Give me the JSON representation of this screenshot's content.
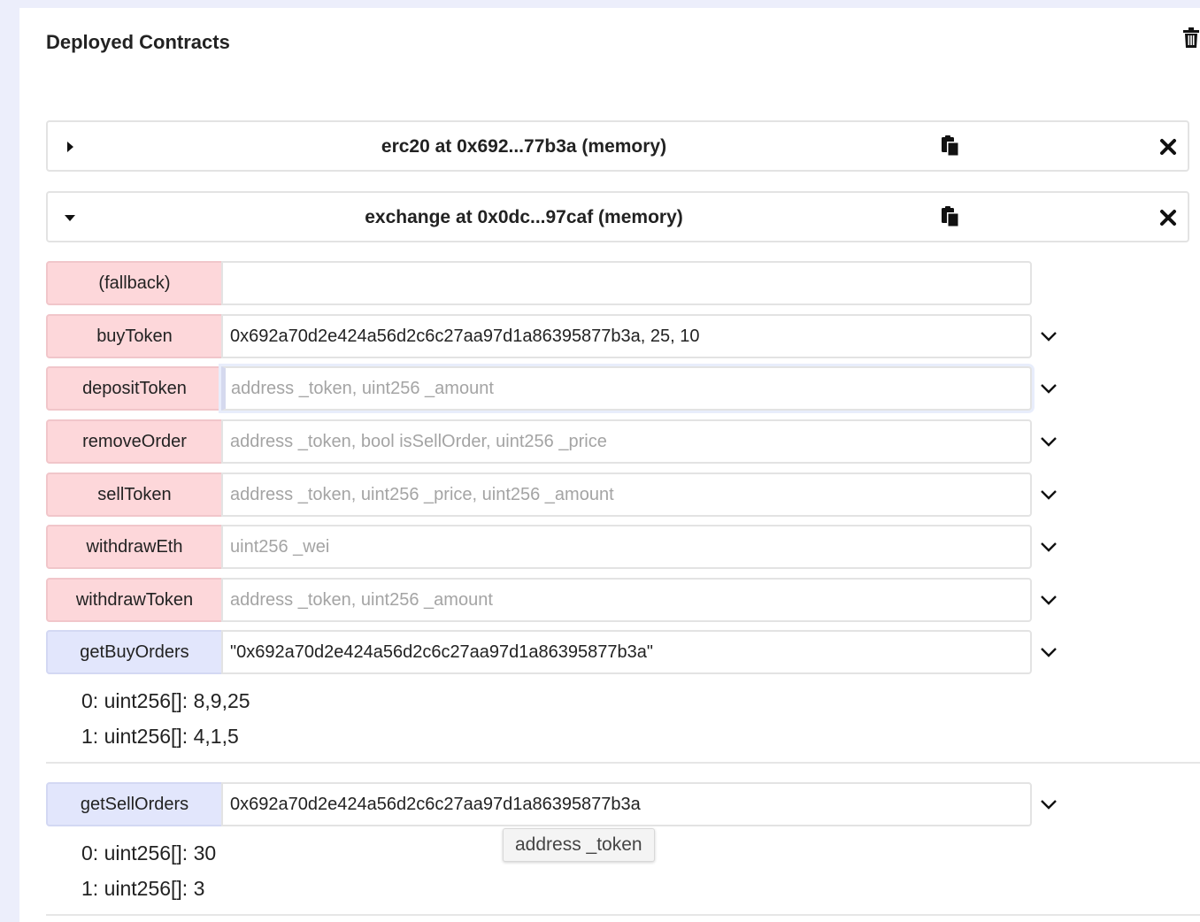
{
  "header": {
    "title": "Deployed Contracts"
  },
  "instances": [
    {
      "title": "erc20 at 0x692...77b3a (memory)",
      "expanded": false
    },
    {
      "title": "exchange at 0x0dc...97caf (memory)",
      "expanded": true
    }
  ],
  "functions": {
    "fallback": {
      "label": "(fallback)",
      "value": "",
      "placeholder": ""
    },
    "buyToken": {
      "label": "buyToken",
      "value": "0x692a70d2e424a56d2c6c27aa97d1a86395877b3a, 25, 10",
      "placeholder": ""
    },
    "depositToken": {
      "label": "depositToken",
      "value": "",
      "placeholder": "address _token, uint256 _amount"
    },
    "removeOrder": {
      "label": "removeOrder",
      "value": "",
      "placeholder": "address _token, bool isSellOrder, uint256 _price"
    },
    "sellToken": {
      "label": "sellToken",
      "value": "",
      "placeholder": "address _token, uint256 _price, uint256 _amount"
    },
    "withdrawEth": {
      "label": "withdrawEth",
      "value": "",
      "placeholder": "uint256 _wei"
    },
    "withdrawToken": {
      "label": "withdrawToken",
      "value": "",
      "placeholder": "address _token, uint256 _amount"
    },
    "getBuyOrders": {
      "label": "getBuyOrders",
      "value": "\"0x692a70d2e424a56d2c6c27aa97d1a86395877b3a\"",
      "placeholder": "",
      "outputs": [
        "0: uint256[]: 8,9,25",
        "1: uint256[]: 4,1,5"
      ]
    },
    "getSellOrders": {
      "label": "getSellOrders",
      "value": "0x692a70d2e424a56d2c6c27aa97d1a86395877b3a",
      "placeholder": "",
      "outputs": [
        "0: uint256[]: 30",
        "1: uint256[]: 3"
      ]
    }
  },
  "tooltip": {
    "text": "address _token"
  },
  "icons": {
    "trash": "trash-icon",
    "copy": "clipboard-copy-icon",
    "close": "close-icon",
    "caret_right": "caret-right-icon",
    "caret_down": "caret-down-icon",
    "chevron": "chevron-down-icon"
  },
  "colors": {
    "transact_button": "#fdd7da",
    "call_button": "#e2e6fc",
    "background": "#eceefb"
  }
}
